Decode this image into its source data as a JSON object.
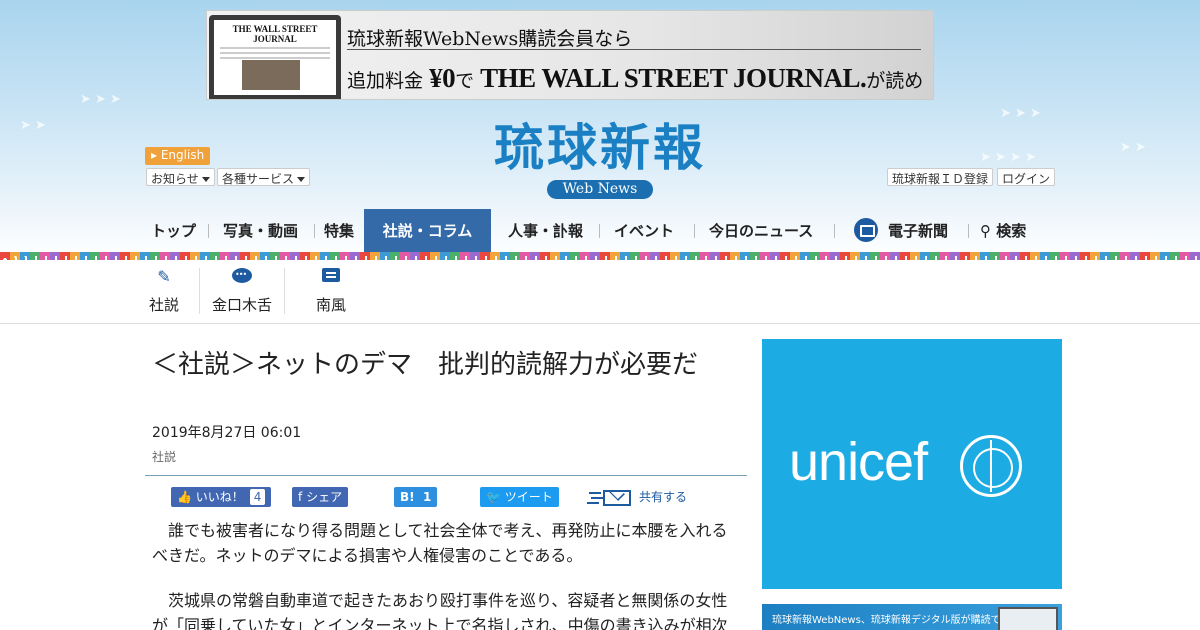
{
  "banner": {
    "line1": "琉球新報WebNews購読会員なら",
    "line2_prefix": "追加料金",
    "line2_price": "¥0",
    "line2_mid": "で",
    "line2_brand": "THE WALL STREET JOURNAL.",
    "line2_suffix": "が読める",
    "laptop_masthead": "THE WALL STREET JOURNAL"
  },
  "logo": {
    "name": "琉球新報",
    "sub": "Web News"
  },
  "header": {
    "english_label": "English",
    "notice_label": "お知らせ",
    "services_label": "各種サービス",
    "register_label": "琉球新報ＩＤ登録",
    "login_label": "ログイン"
  },
  "nav": {
    "items": [
      "トップ",
      "写真・動画",
      "特集",
      "社説・コラム",
      "人事・訃報",
      "イベント",
      "今日のニュース",
      "電子新聞",
      "検索"
    ],
    "active": "社説・コラム"
  },
  "subnav": {
    "items": [
      "社説",
      "金口木舌",
      "南風"
    ]
  },
  "article": {
    "title": "＜社説＞ネットのデマ　批判的読解力が必要だ",
    "date": "2019年8月27日 06:01",
    "category": "社説",
    "paragraphs": [
      "誰でも被害者になり得る問題として社会全体で考え、再発防止に本腰を入れるべきだ。ネットのデマによる損害や人権侵害のことである。",
      "茨城県の常磐自動車道で起きたあおり殴打事件を巡り、容疑者と無関係の女性が「同乗していた女」とインターネット上で名指しされ、中傷の書き込みが相次"
    ]
  },
  "share": {
    "like_label": "いいね！",
    "like_count": "4",
    "share_label": "シェア",
    "hatena_label": "B!",
    "hatena_count": "1",
    "tweet_label": "ツイート",
    "mail_label": "共有する"
  },
  "ads": {
    "unicef_text": "unicef",
    "webnews_text": "琉球新報WebNews、琉球新報デジタル版が購読できる"
  },
  "colors": {
    "nav_active": "#346aa8",
    "logo_blue": "#1b7fc4",
    "unicef_blue": "#1cabe2",
    "facebook": "#4267b2",
    "twitter": "#1d9bf0",
    "english_badge": "#f0a13a"
  }
}
